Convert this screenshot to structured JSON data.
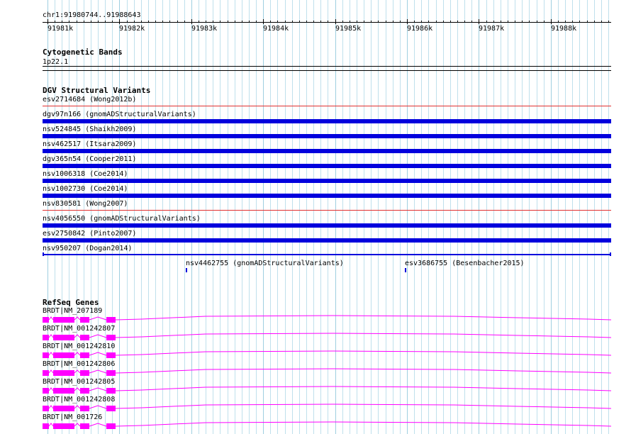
{
  "ruler": {
    "coordinates": "chr1:91980744..91988643",
    "ticks": [
      "91981k",
      "91982k",
      "91983k",
      "91984k",
      "91985k",
      "91986k",
      "91987k",
      "91988k"
    ]
  },
  "cytoband": {
    "title": "Cytogenetic Bands",
    "band": "1p22.1"
  },
  "dgv": {
    "title": "DGV Structural Variants",
    "variants": [
      {
        "label": "esv2714684 (Wong2012b)",
        "color": "#e03030",
        "style": "line"
      },
      {
        "label": "dgv97n166 (gnomADStructuralVariants)",
        "color": "#0000dd",
        "style": "bar"
      },
      {
        "label": "nsv524845 (Shaikh2009)",
        "color": "#0000dd",
        "style": "bar"
      },
      {
        "label": "nsv462517 (Itsara2009)",
        "color": "#0000dd",
        "style": "bar"
      },
      {
        "label": "dgv365n54 (Cooper2011)",
        "color": "#0000dd",
        "style": "bar"
      },
      {
        "label": "nsv1006318 (Coe2014)",
        "color": "#0000dd",
        "style": "bar"
      },
      {
        "label": "nsv1002730 (Coe2014)",
        "color": "#0000dd",
        "style": "bar"
      },
      {
        "label": "nsv830581 (Wong2007)",
        "color": "#e03030",
        "style": "line"
      },
      {
        "label": "nsv4056550 (gnomADStructuralVariants)",
        "color": "#0000dd",
        "style": "bar"
      },
      {
        "label": "esv2750842 (Pinto2007)",
        "color": "#0000dd",
        "style": "bar"
      },
      {
        "label": "nsv950207 (Dogan2014)",
        "color": "#0000dd",
        "style": "thin"
      }
    ],
    "small_variants": [
      {
        "label": "nsv4462755 (gnomADStructuralVariants)"
      },
      {
        "label": "esv3686755 (Besenbacher2015)"
      }
    ]
  },
  "refseq": {
    "title": "RefSeq Genes",
    "color": "#ff00ff",
    "genes": [
      {
        "label": "BRDT|NM_207189"
      },
      {
        "label": "BRDT|NM_001242807"
      },
      {
        "label": "BRDT|NM_001242810"
      },
      {
        "label": "BRDT|NM_001242806"
      },
      {
        "label": "BRDT|NM_001242805"
      },
      {
        "label": "BRDT|NM_001242808"
      },
      {
        "label": "BRDT|NM_001726"
      }
    ]
  }
}
